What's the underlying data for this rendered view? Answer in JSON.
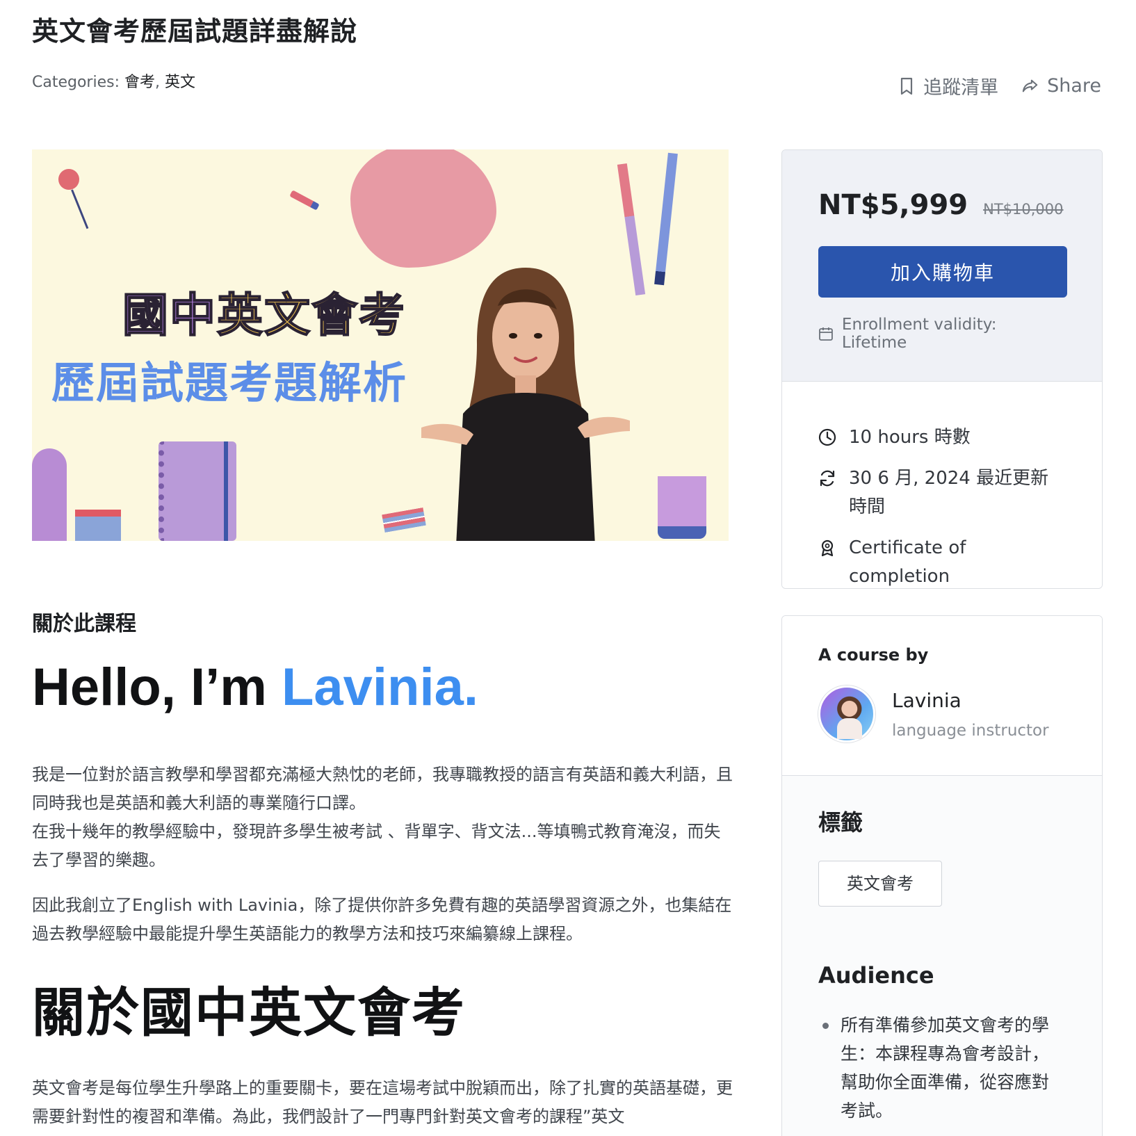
{
  "course": {
    "title": "英文會考歷屆試題詳盡解說",
    "categories_label": "Categories:",
    "categories": [
      "會考",
      "英文"
    ]
  },
  "actions": {
    "watchlist": "追蹤清單",
    "share": "Share"
  },
  "hero": {
    "title_part1": "國中",
    "title_part2": "英文會考",
    "title_line2": "歷屆試題考題解析"
  },
  "pricing": {
    "price": "NT$5,999",
    "original_price": "NT$10,000",
    "cart_button": "加入購物車",
    "validity": "Enrollment validity: Lifetime"
  },
  "features": [
    {
      "icon": "clock-icon",
      "text": "10 hours  時數"
    },
    {
      "icon": "refresh-icon",
      "text": "30 6 月, 2024 最近更新時間"
    },
    {
      "icon": "certificate-icon",
      "text": "Certificate of completion"
    }
  ],
  "instructor": {
    "label": "A course by",
    "name": "Lavinia",
    "role": "language instructor"
  },
  "tags": {
    "heading": "標籤",
    "items": [
      "英文會考"
    ]
  },
  "audience": {
    "heading": "Audience",
    "items": [
      "所有準備參加英文會考的學生：本課程專為會考設計，幫助你全面準備，從容應對考試。"
    ]
  },
  "about": {
    "label": "關於此課程",
    "hello_prefix": "Hello, I’m ",
    "hello_name": "Lavinia.",
    "para1_line1": "我是一位對於語言教學和學習都充滿極大熱忱的老師，我專職教授的語言有英語和義大利語，且同時我也是英語和義大利語的專業隨行口譯。",
    "para1_line2": "在我十幾年的教學經驗中，發現許多學生被考試 、背單字、背文法...等填鴨式教育淹沒，而失去了學習的樂趣。",
    "para2": "因此我創立了English with Lavinia，除了提供你許多免費有趣的英語學習資源之外，也集結在過去教學經驗中最能提升學生英語能力的教學方法和技巧來編纂線上課程。",
    "heading2": "關於國中英文會考",
    "para3": "英文會考是每位學生升學路上的重要關卡，要在這場考試中脫穎而出，除了扎實的英語基礎，更需要針對性的複習和準備。為此，我們設計了一門專門針對英文會考的課程”英文"
  },
  "colors": {
    "primary_button": "#2a55ad",
    "accent_name": "#3d8ef0"
  }
}
